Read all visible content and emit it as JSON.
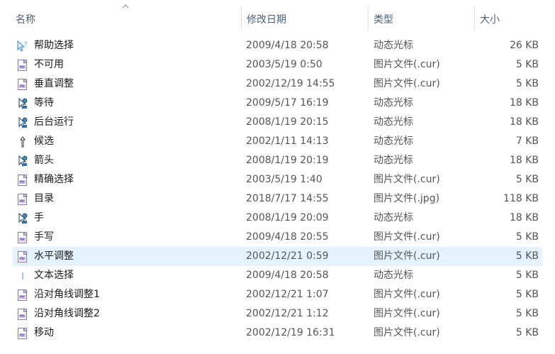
{
  "header": {
    "name": "名称",
    "date": "修改日期",
    "type": "类型",
    "size": "大小"
  },
  "files": [
    {
      "name": "帮助选择",
      "date": "2009/4/18 20:58",
      "type": "动态光标",
      "size": "26 KB",
      "icon": "help-select-cursor-icon"
    },
    {
      "name": "不可用",
      "date": "2003/5/19 0:50",
      "type": "图片文件(.cur)",
      "size": "5 KB",
      "icon": "image-file-icon"
    },
    {
      "name": "垂直调整",
      "date": "2002/12/19 14:55",
      "type": "图片文件(.cur)",
      "size": "5 KB",
      "icon": "image-file-icon"
    },
    {
      "name": "等待",
      "date": "2009/5/17 16:19",
      "type": "动态光标",
      "size": "18 KB",
      "icon": "animated-cursor-icon"
    },
    {
      "name": "后台运行",
      "date": "2008/1/19 20:15",
      "type": "动态光标",
      "size": "18 KB",
      "icon": "animated-cursor-icon"
    },
    {
      "name": "候选",
      "date": "2002/1/11 14:13",
      "type": "动态光标",
      "size": "7 KB",
      "icon": "alternate-cursor-icon"
    },
    {
      "name": "箭头",
      "date": "2008/1/19 20:19",
      "type": "动态光标",
      "size": "18 KB",
      "icon": "animated-cursor-icon"
    },
    {
      "name": "精确选择",
      "date": "2003/5/19 1:40",
      "type": "图片文件(.cur)",
      "size": "5 KB",
      "icon": "image-file-icon"
    },
    {
      "name": "目录",
      "date": "2018/7/17 14:55",
      "type": "图片文件(.jpg)",
      "size": "118 KB",
      "icon": "image-file-icon"
    },
    {
      "name": "手",
      "date": "2008/1/19 20:09",
      "type": "动态光标",
      "size": "18 KB",
      "icon": "animated-cursor-icon"
    },
    {
      "name": "手写",
      "date": "2009/4/18 20:55",
      "type": "图片文件(.cur)",
      "size": "5 KB",
      "icon": "image-file-icon"
    },
    {
      "name": "水平调整",
      "date": "2002/12/21 0:59",
      "type": "图片文件(.cur)",
      "size": "5 KB",
      "icon": "image-file-icon",
      "selected": true
    },
    {
      "name": "文本选择",
      "date": "2009/4/18 20:58",
      "type": "动态光标",
      "size": "5 KB",
      "icon": "text-select-cursor-icon"
    },
    {
      "name": "沿对角线调整1",
      "date": "2002/12/21 1:07",
      "type": "图片文件(.cur)",
      "size": "5 KB",
      "icon": "image-file-icon"
    },
    {
      "name": "沿对角线调整2",
      "date": "2002/12/21 1:12",
      "type": "图片文件(.cur)",
      "size": "5 KB",
      "icon": "image-file-icon"
    },
    {
      "name": "移动",
      "date": "2002/12/19 16:31",
      "type": "图片文件(.cur)",
      "size": "5 KB",
      "icon": "image-file-icon"
    }
  ],
  "colors": {
    "header_text": "#4c607a",
    "selection": "#e5f3ff"
  }
}
